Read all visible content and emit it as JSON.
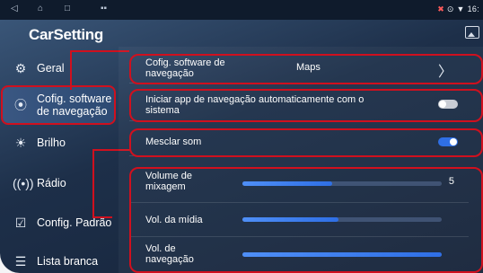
{
  "status_bar": {
    "right_text": "16:",
    "icons": [
      "location-icon",
      "wifi-icon"
    ]
  },
  "title": "CarSetting",
  "sidebar": {
    "items": [
      {
        "label": "Geral",
        "icon": "gear-icon"
      },
      {
        "label": "Cofig. software de navegação",
        "icon": "location-pin-icon",
        "active": true
      },
      {
        "label": "Brilho",
        "icon": "brightness-icon"
      },
      {
        "label": "Rádio",
        "icon": "radio-icon"
      },
      {
        "label": "Config. Padrão",
        "icon": "checkbox-icon"
      },
      {
        "label": "Lista branca",
        "icon": "list-icon"
      }
    ]
  },
  "settings": {
    "nav_software": {
      "label": "Cofig. software de navegação",
      "value": "Maps"
    },
    "auto_start": {
      "label": "Iniciar app de navegação automaticamente com o sistema",
      "enabled": false
    },
    "mix_sound": {
      "label": "Mesclar som",
      "enabled": true
    },
    "mix_volume": {
      "label": "Volume de mixagem",
      "value": "5",
      "level": 0.45
    },
    "media_volume": {
      "label": "Vol. da mídia",
      "level": 0.48
    },
    "nav_volume": {
      "label": "Vol. de navegação",
      "level": 1.0
    }
  },
  "colors": {
    "accent": "#2f6fe5",
    "highlight": "#d0101e",
    "toggle_off": "#c8ccd4"
  }
}
